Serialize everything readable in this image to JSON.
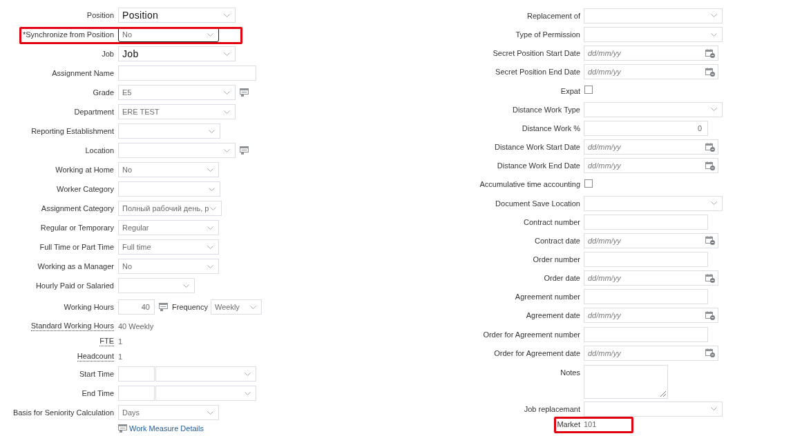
{
  "left_fields": [
    {
      "kind": "select",
      "label": "Position",
      "value": "Position",
      "emphasis": true,
      "focused": false,
      "highlighted": false
    },
    {
      "kind": "select",
      "label": "*Synchronize from Position",
      "value": "No",
      "emphasis": false,
      "focused": true,
      "highlighted": true
    },
    {
      "kind": "select",
      "label": "Job",
      "value": "Job",
      "emphasis": true,
      "focused": false,
      "highlighted": false
    },
    {
      "kind": "text",
      "label": "Assignment Name",
      "highlighted": false
    },
    {
      "kind": "lov",
      "label": "Grade",
      "value": "E5",
      "emphasis": false,
      "focused": false,
      "highlighted": false
    },
    {
      "kind": "select",
      "label": "Department",
      "value": "ERE TEST",
      "emphasis": false,
      "focused": false,
      "highlighted": false
    },
    {
      "kind": "select",
      "label": "Reporting Establishment",
      "focused": false,
      "highlighted": false
    },
    {
      "kind": "lov",
      "label": "Location",
      "focused": false,
      "highlighted": false
    },
    {
      "kind": "select",
      "label": "Working at Home",
      "value": "No",
      "emphasis": false,
      "focused": false,
      "highlighted": false
    },
    {
      "kind": "select",
      "label": "Worker Category",
      "focused": false,
      "highlighted": false
    },
    {
      "kind": "select",
      "label": "Assignment Category",
      "value": "Полный рабочий день, р",
      "emphasis": false,
      "focused": false,
      "highlighted": false
    },
    {
      "kind": "select",
      "label": "Regular or Temporary",
      "value": "Regular",
      "emphasis": false,
      "focused": false,
      "highlighted": false
    },
    {
      "kind": "select",
      "label": "Full Time or Part Time",
      "value": "Full time",
      "emphasis": false,
      "focused": false,
      "highlighted": false
    },
    {
      "kind": "select",
      "label": "Working as a Manager",
      "value": "No",
      "emphasis": false,
      "focused": false,
      "highlighted": false
    },
    {
      "kind": "select",
      "label": "Hourly Paid or Salaried",
      "focused": false,
      "highlighted": false
    },
    {
      "kind": "hours",
      "label": "Working Hours",
      "value": "40",
      "frequency_label": "Frequency",
      "frequency": "Weekly",
      "highlighted": false
    },
    {
      "kind": "display",
      "label": "Standard Working Hours",
      "value": "40 Weekly",
      "highlighted": false
    },
    {
      "kind": "display",
      "label": "FTE",
      "value": "1",
      "highlighted": false
    },
    {
      "kind": "display",
      "label": "Headcount",
      "value": "1",
      "highlighted": false
    },
    {
      "kind": "time",
      "label": "Start Time",
      "highlighted": false
    },
    {
      "kind": "time",
      "label": "End Time",
      "highlighted": false
    },
    {
      "kind": "select",
      "label": "Basis for Seniority Calculation",
      "value": "Days",
      "emphasis": false,
      "focused": false,
      "highlighted": false
    },
    {
      "kind": "link",
      "label": "Work Measure Details",
      "highlighted": false
    }
  ],
  "right_fields": [
    {
      "kind": "select",
      "label": "Replacement of",
      "highlighted": false
    },
    {
      "kind": "select",
      "label": "Type of Permission",
      "highlighted": false
    },
    {
      "kind": "date",
      "label": "Secret Position Start Date",
      "placeholder": "dd/mm/yy",
      "highlighted": false
    },
    {
      "kind": "date",
      "label": "Secret Position End Date",
      "placeholder": "dd/mm/yy",
      "highlighted": false
    },
    {
      "kind": "checkbox",
      "label": "Expat",
      "checked": false,
      "highlighted": false
    },
    {
      "kind": "select",
      "label": "Distance Work Type",
      "highlighted": false
    },
    {
      "kind": "number",
      "label": "Distance Work %",
      "value": "0",
      "highlighted": false
    },
    {
      "kind": "date",
      "label": "Distance Work Start Date",
      "placeholder": "dd/mm/yy",
      "highlighted": false
    },
    {
      "kind": "date",
      "label": "Distance Work End Date",
      "placeholder": "dd/mm/yy",
      "highlighted": false
    },
    {
      "kind": "checkbox",
      "label": "Accumulative time accounting",
      "checked": false,
      "highlighted": false
    },
    {
      "kind": "select",
      "label": "Document Save Location",
      "highlighted": false
    },
    {
      "kind": "text",
      "label": "Contract number",
      "highlighted": false
    },
    {
      "kind": "date",
      "label": "Contract date",
      "placeholder": "dd/mm/yy",
      "highlighted": false
    },
    {
      "kind": "text",
      "label": "Order number",
      "highlighted": false
    },
    {
      "kind": "date",
      "label": "Order date",
      "placeholder": "dd/mm/yy",
      "highlighted": false
    },
    {
      "kind": "text",
      "label": "Agreement number",
      "highlighted": false
    },
    {
      "kind": "date",
      "label": "Agreement date",
      "placeholder": "dd/mm/yy",
      "highlighted": false
    },
    {
      "kind": "text",
      "label": "Order for Agreement number",
      "highlighted": false
    },
    {
      "kind": "date",
      "label": "Order for Agreement date",
      "placeholder": "dd/mm/yy",
      "highlighted": false
    },
    {
      "kind": "textarea",
      "label": "Notes",
      "highlighted": false
    },
    {
      "kind": "select",
      "label": "Job replacemant",
      "highlighted": false
    },
    {
      "kind": "display",
      "label": "Market",
      "value": "101",
      "highlighted": true
    }
  ]
}
